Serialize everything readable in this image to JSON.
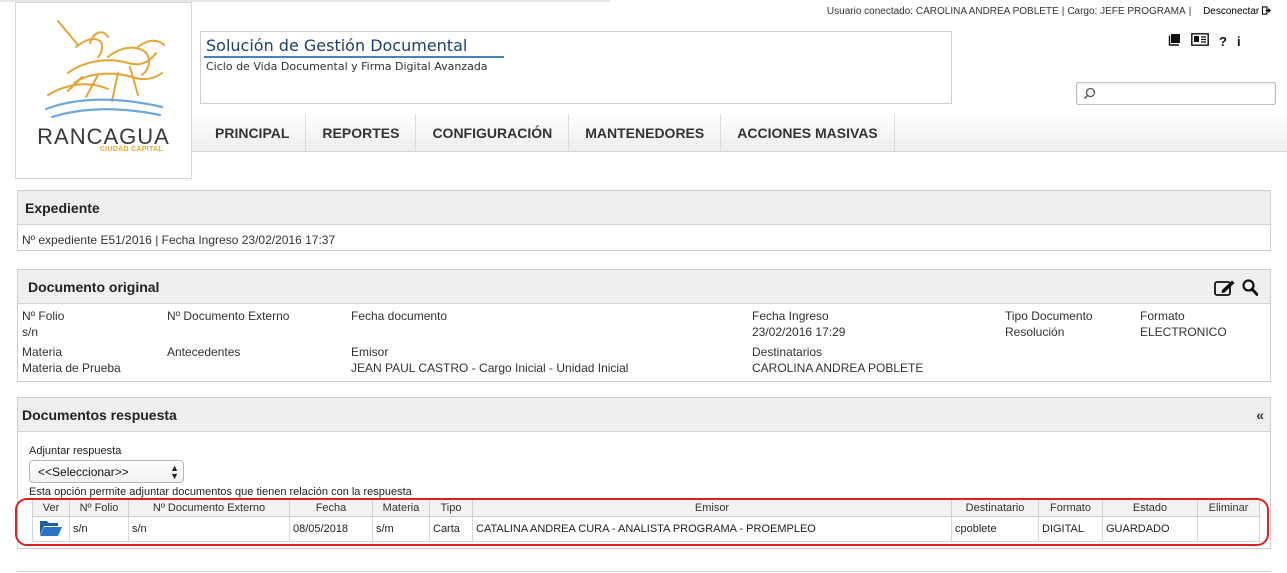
{
  "session": {
    "user_label": "Usuario conectado:",
    "user_name": "CAROLINA ANDREA POBLETE",
    "role_label": "Cargo:",
    "role": "JEFE PROGRAMA",
    "logout": "Desconectar"
  },
  "logo": {
    "name": "RANCAGUA",
    "sub": "CIUDAD CAPITAL"
  },
  "app": {
    "title": "Solución de Gestión Documental",
    "subtitle": "Ciclo de Vida Documental y Firma Digital Avanzada"
  },
  "toolbar_icons": [
    "book-icon",
    "id-card-icon",
    "help-icon",
    "info-icon"
  ],
  "toolbar_glyphs": {
    "help": "?",
    "info": "i"
  },
  "search": {
    "placeholder": ""
  },
  "nav": [
    "PRINCIPAL",
    "REPORTES",
    "CONFIGURACIÓN",
    "MANTENEDORES",
    "ACCIONES MASIVAS"
  ],
  "expediente": {
    "title": "Expediente",
    "number_label": "Nº expediente",
    "number": "E51/2016",
    "date_label": "Fecha Ingreso",
    "date": "23/02/2016 17:37"
  },
  "documento_original": {
    "title": "Documento original",
    "folio_label": "Nº Folio",
    "folio": "s/n",
    "doc_ext_label": "Nº Documento Externo",
    "doc_ext": "",
    "fecha_doc_label": "Fecha documento",
    "fecha_doc": "",
    "fecha_ingreso_label": "Fecha Ingreso",
    "fecha_ingreso": "23/02/2016 17:29",
    "tipo_label": "Tipo Documento",
    "tipo": "Resolución",
    "formato_label": "Formato",
    "formato": "ELECTRONICO",
    "materia_label": "Materia",
    "materia": "Materia de Prueba",
    "antecedentes_label": "Antecedentes",
    "antecedentes": "",
    "emisor_label": "Emisor",
    "emisor": "JEAN PAUL CASTRO - Cargo Inicial - Unidad Inicial",
    "destinatarios_label": "Destinatarios",
    "destinatarios": "CAROLINA ANDREA POBLETE"
  },
  "respuestas": {
    "title": "Documentos respuesta",
    "collapse": "«",
    "adjuntar_label": "Adjuntar respuesta",
    "select_value": "<<Seleccionar>>",
    "hint": "Esta opción permite adjuntar documentos que tienen relación con la respuesta",
    "columns": [
      "Ver",
      "Nº Folio",
      "Nº Documento Externo",
      "Fecha",
      "Materia",
      "Tipo",
      "Emisor",
      "Destinatario",
      "Formato",
      "Estado",
      "Eliminar"
    ],
    "rows": [
      {
        "folio": "s/n",
        "doc_ext": "s/n",
        "fecha": "08/05/2018",
        "materia": "s/m",
        "tipo": "Carta",
        "emisor": "CATALINA ANDREA CURA - ANALISTA PROGRAMA - PROEMPLEO",
        "destinatario": "cpoblete",
        "formato": "DIGITAL",
        "estado": "GUARDADO",
        "eliminar": ""
      }
    ]
  },
  "colors": {
    "accent_blue": "#1d3f72",
    "highlight_red": "#e0201f",
    "folder_blue": "#1f5fa8"
  }
}
